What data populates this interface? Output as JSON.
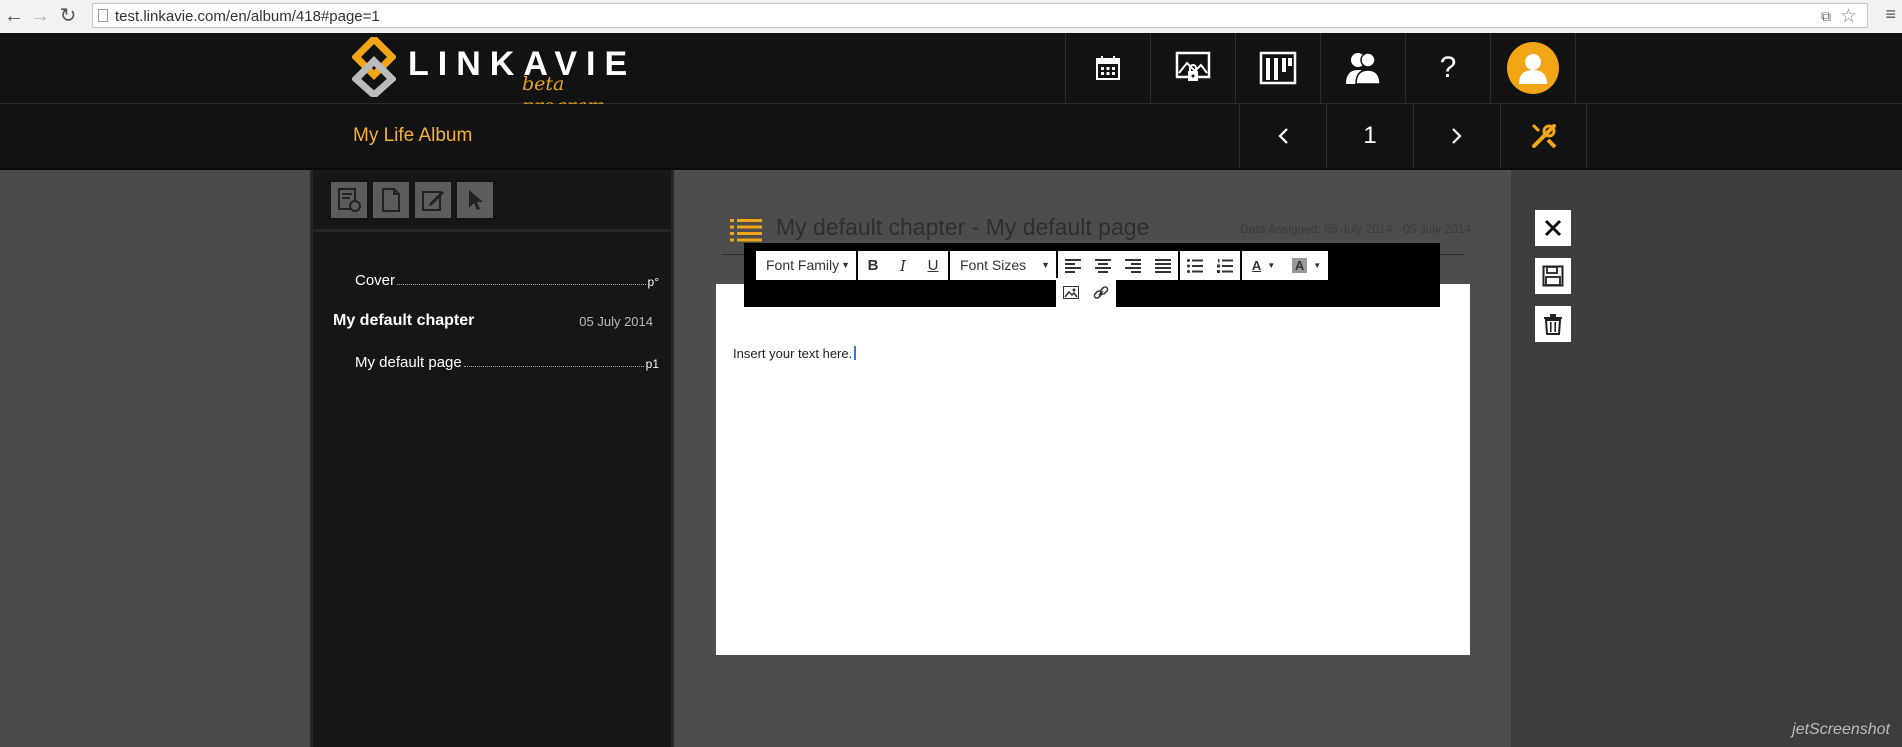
{
  "browser": {
    "url": "test.linkavie.com/en/album/418#page=1"
  },
  "header": {
    "logo_text": "LINKAVIE",
    "logo_tagline": "beta program",
    "nav": [
      {
        "icon": "calendar-icon"
      },
      {
        "icon": "photo-lock-icon"
      },
      {
        "icon": "grid-icon"
      },
      {
        "icon": "people-icon"
      },
      {
        "icon": "help-icon",
        "label": "?"
      },
      {
        "icon": "user-avatar-icon"
      }
    ],
    "accent_color": "#f2a515"
  },
  "subbar": {
    "album_title": "My Life Album",
    "page_number": "1",
    "prev_label": "‹",
    "next_label": "›"
  },
  "sidebar": {
    "tools": [
      "add-chapter-icon",
      "add-page-icon",
      "edit-icon",
      "select-icon"
    ],
    "cover": {
      "label": "Cover",
      "page": "p°"
    },
    "chapter": {
      "title": "My default chapter",
      "date": "05 July 2014"
    },
    "pages": [
      {
        "label": "My default page",
        "page": "p1"
      }
    ]
  },
  "editor": {
    "chapter_heading": "My default chapter - My default page",
    "date_assigned": "Data Assigned: 05 July 2014 - 05 July 2014",
    "font_family_label": "Font Family",
    "font_sizes_label": "Font Sizes",
    "bold": "B",
    "italic": "I",
    "underline": "U",
    "text": "Insert your text here."
  },
  "watermark": "jetScreenshot"
}
